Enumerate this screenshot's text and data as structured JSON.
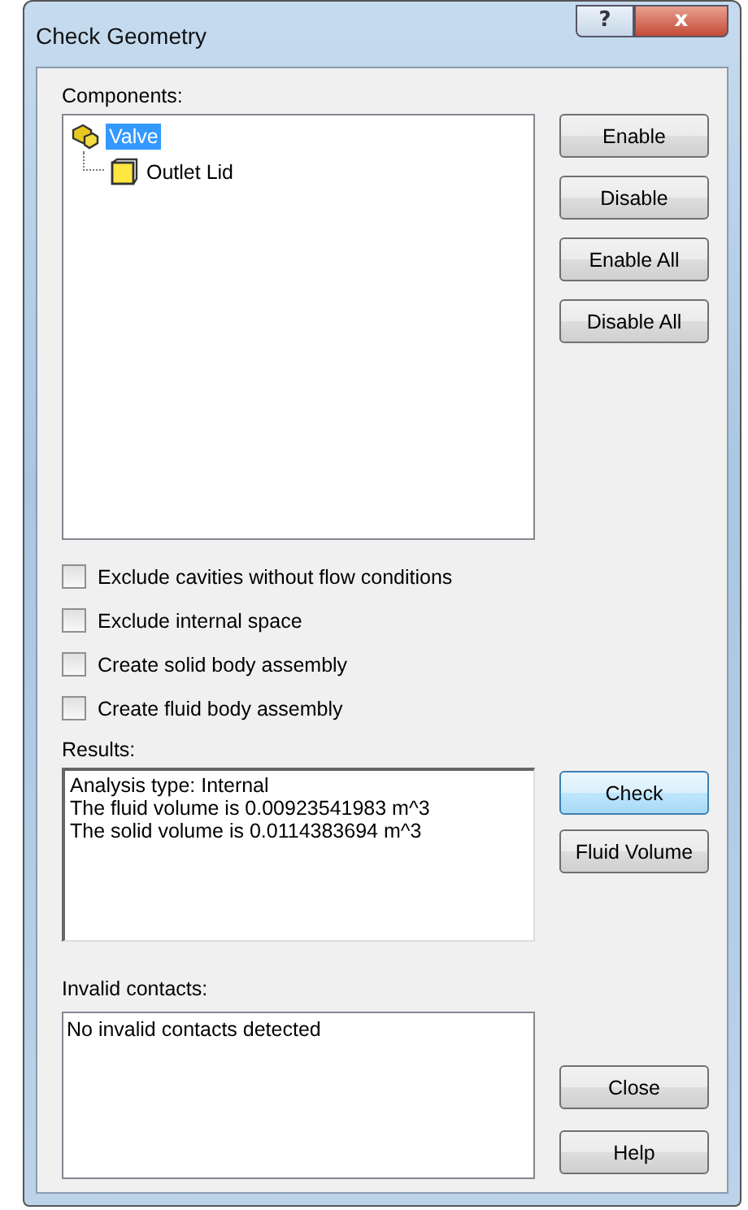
{
  "window": {
    "title": "Check Geometry",
    "help_glyph": "?",
    "close_glyph": "x"
  },
  "components": {
    "label": "Components:",
    "tree": [
      {
        "name": "Valve",
        "kind": "assembly",
        "selected": true,
        "children": [
          {
            "name": "Outlet Lid",
            "kind": "part",
            "selected": false
          }
        ]
      }
    ]
  },
  "component_buttons": [
    "Enable",
    "Disable",
    "Enable All",
    "Disable All"
  ],
  "options": [
    {
      "label": "Exclude cavities without flow conditions",
      "checked": false
    },
    {
      "label": "Exclude internal space",
      "checked": false
    },
    {
      "label": "Create solid body assembly",
      "checked": false
    },
    {
      "label": "Create fluid body assembly",
      "checked": false
    }
  ],
  "results": {
    "label": "Results:",
    "lines": [
      "Analysis type: Internal",
      "The fluid volume is 0.00923541983 m^3",
      "The solid volume is 0.0114383694 m^3"
    ]
  },
  "result_buttons": [
    {
      "label": "Check",
      "focused": true
    },
    {
      "label": "Fluid Volume",
      "focused": false
    }
  ],
  "invalid_contacts": {
    "label": "Invalid contacts:",
    "lines": [
      "No invalid contacts detected"
    ]
  },
  "footer_buttons": [
    "Close",
    "Help"
  ]
}
